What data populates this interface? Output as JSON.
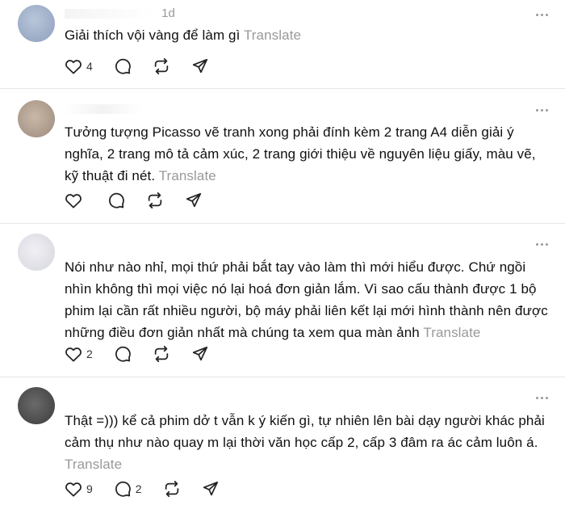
{
  "posts": [
    {
      "avatar_color": "#9fb0c8",
      "time": "1d",
      "text": "Giải thích vội vàng để làm gì",
      "translate": "Translate",
      "likes": "4",
      "replies": "",
      "icons": [
        "heart-icon",
        "comment-icon",
        "repost-icon",
        "share-icon"
      ]
    },
    {
      "avatar_color": "#b7a596",
      "time": "",
      "text": "Tưởng tượng Picasso vẽ tranh xong phải đính kèm 2 trang A4 diễn giải ý nghĩa, 2 trang mô tả cảm xúc, 2 trang giới thiệu về nguyên liệu giấy, màu vẽ, kỹ thuật đi nét.",
      "translate": "Translate",
      "likes": "",
      "replies": ""
    },
    {
      "avatar_color": "#e4e4ea",
      "time": "",
      "text": "Nói như nào nhỉ, mọi thứ phải bắt tay vào làm thì mới hiểu được. Chứ ngồi nhìn không thì mọi việc nó lại hoá đơn giản lắm. Vì sao cấu thành được 1 bộ phim lại cần rất nhiều người, bộ máy phải liên kết lại mới hình thành nên được những điều đơn giản nhất mà chúng ta xem qua màn ảnh",
      "translate": "Translate",
      "likes": "2",
      "replies": ""
    },
    {
      "avatar_color": "#555555",
      "time": "",
      "text": "Thật =))) kể cả phim dở t vẫn k ý kiến gì, tự nhiên lên bài dạy người khác phải cảm thụ như nào quay m lại thời văn học cấp 2, cấp 3 đâm ra ác cảm luôn á.",
      "translate": "Translate",
      "likes": "9",
      "replies": "2"
    }
  ]
}
